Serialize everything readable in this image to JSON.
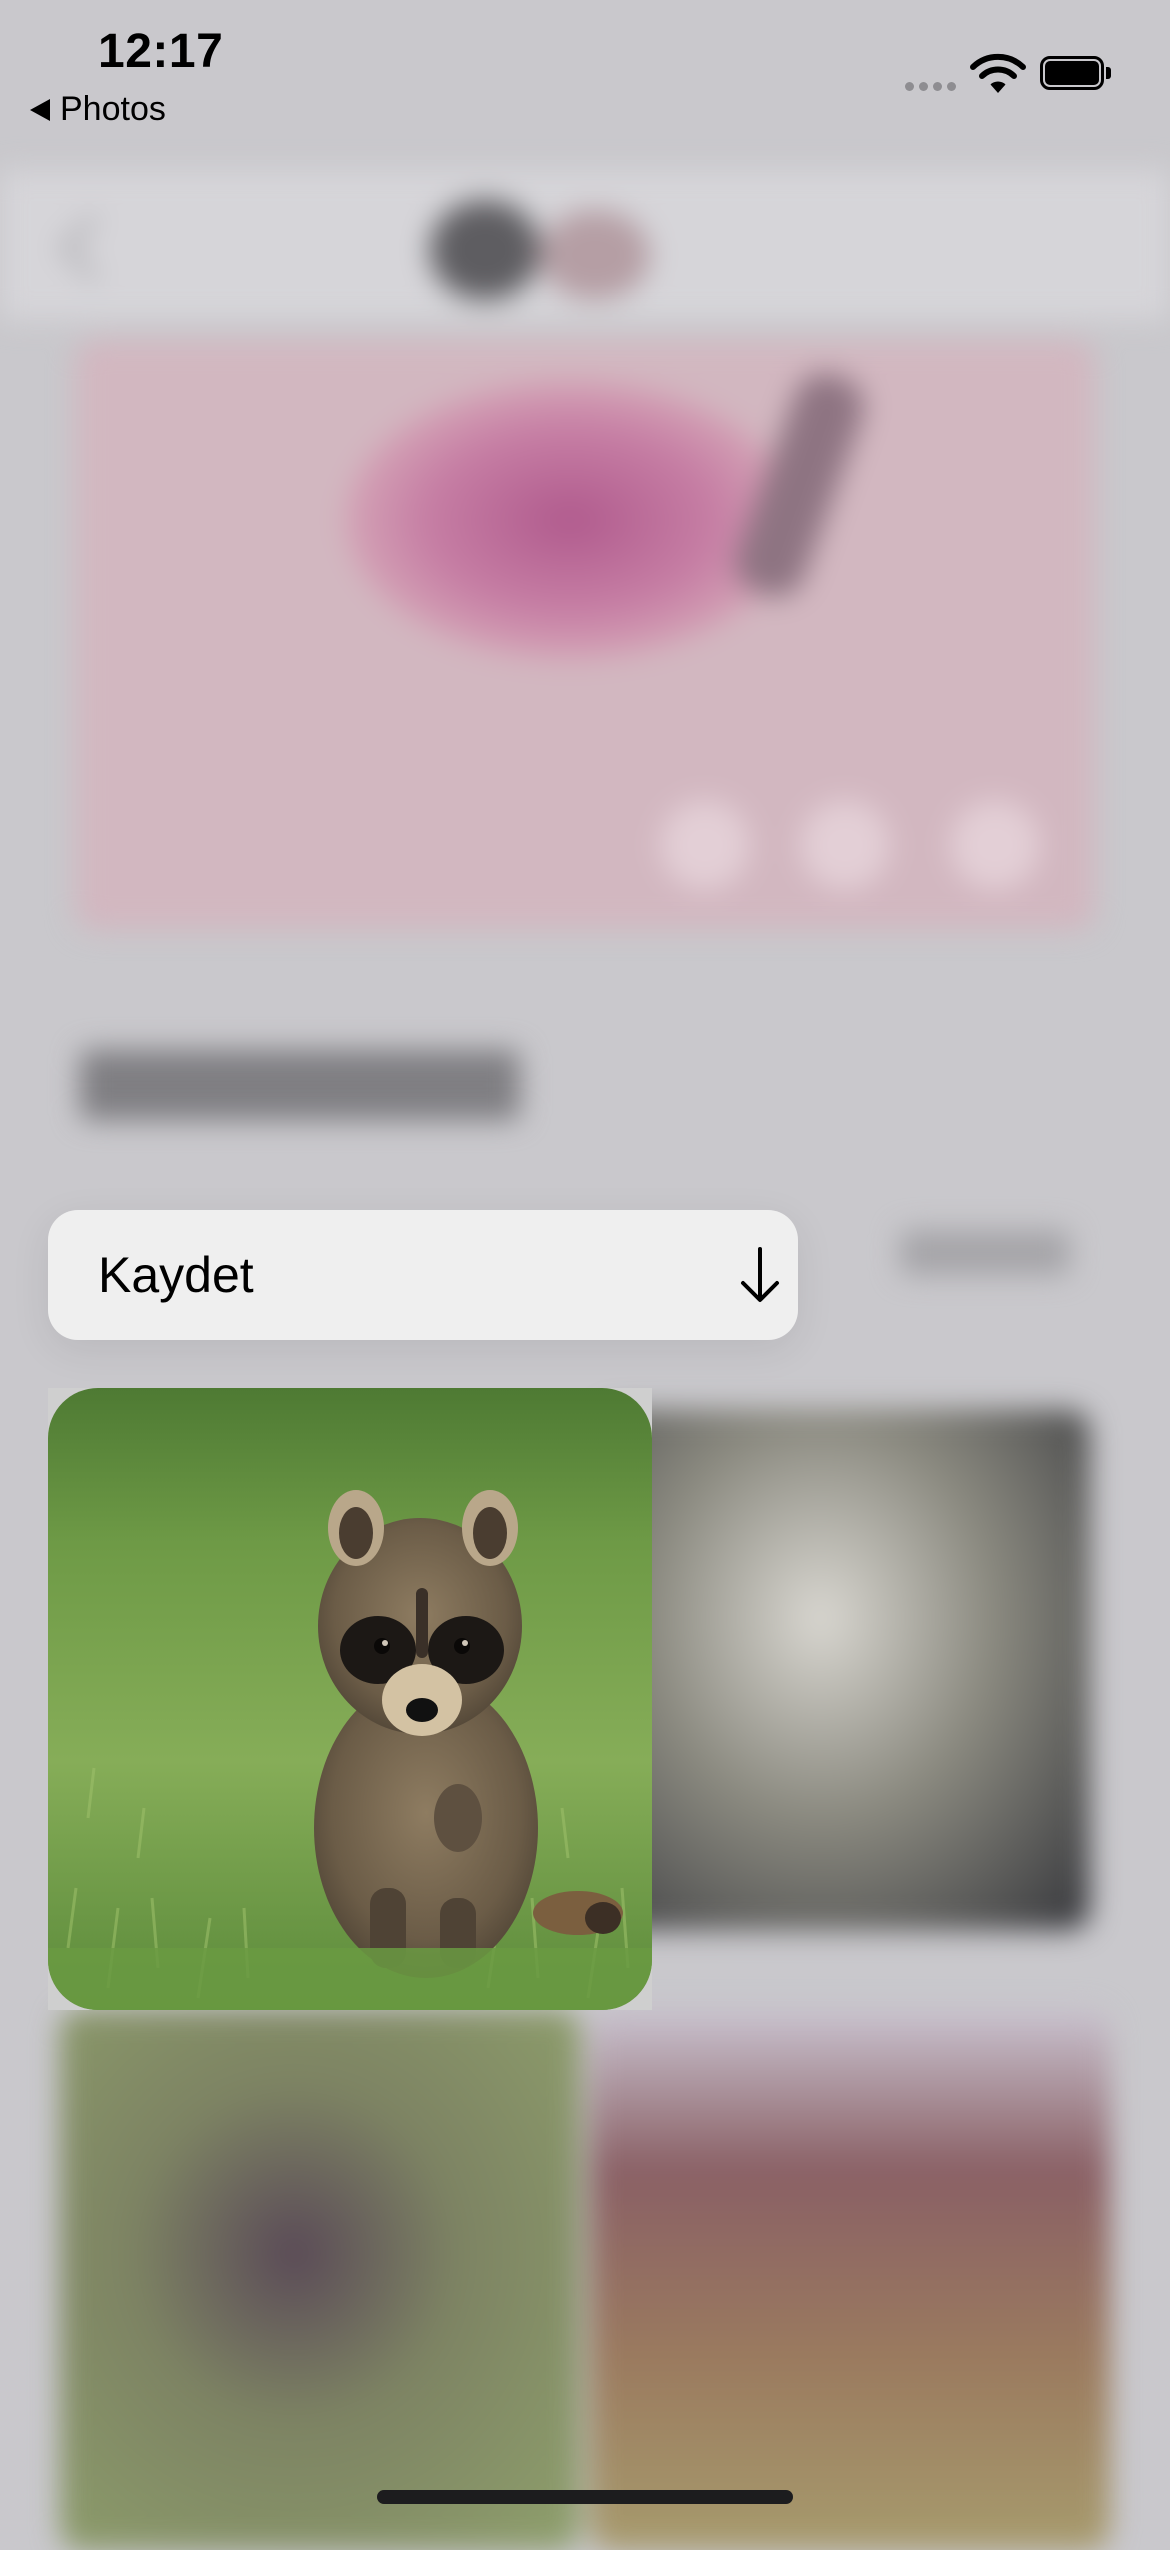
{
  "status_bar": {
    "time": "12:17",
    "back_app": "Photos",
    "wifi_icon": "wifi-icon",
    "battery_icon": "battery-icon"
  },
  "context_menu": {
    "items": [
      {
        "label": "Kaydet",
        "icon": "download-arrow-icon"
      }
    ]
  },
  "preview": {
    "subject": "raccoon-photo",
    "selected": true
  },
  "colors": {
    "dim_background": "#c9c8cc",
    "menu_background": "#f0f0f0",
    "text": "#000000"
  }
}
